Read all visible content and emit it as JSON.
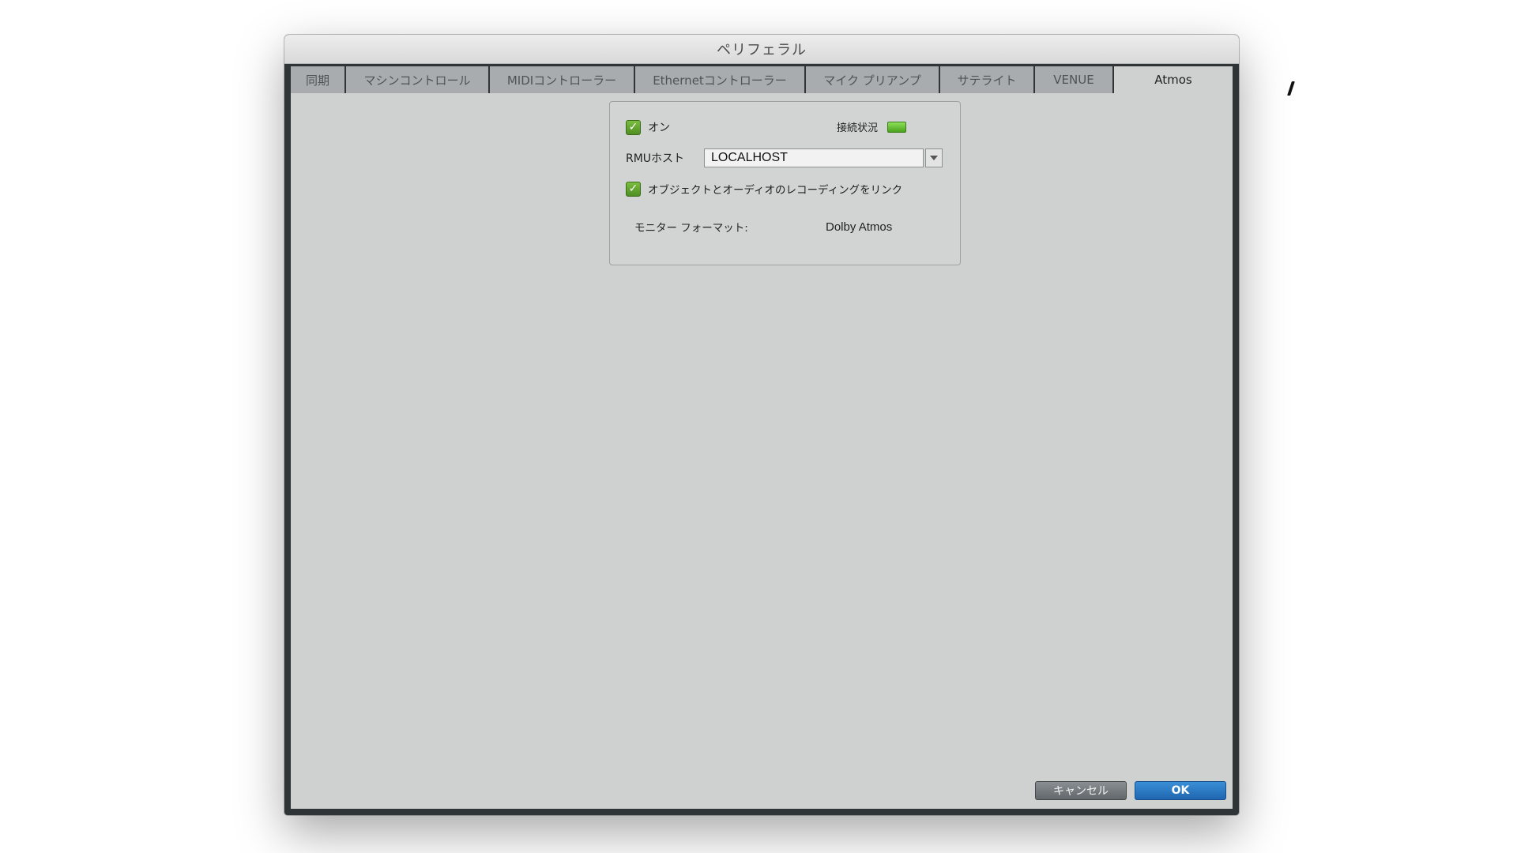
{
  "window": {
    "title": "ペリフェラル"
  },
  "tabs": [
    {
      "label": "同期"
    },
    {
      "label": "マシンコントロール"
    },
    {
      "label": "MIDIコントローラー"
    },
    {
      "label": "Ethernetコントローラー"
    },
    {
      "label": "マイク プリアンプ"
    },
    {
      "label": "サテライト"
    },
    {
      "label": "VENUE"
    },
    {
      "label": "Atmos",
      "active": true
    }
  ],
  "atmos": {
    "on_label": "オン",
    "on_checked": true,
    "connection_label": "接続状況",
    "connection_status_color": "#5fc22e",
    "rmu_host_label": "RMUホスト",
    "rmu_host_value": "LOCALHOST",
    "link_label": "オブジェクトとオーディオのレコーディングをリンク",
    "link_checked": true,
    "monitor_format_label": "モニター フォーマット:",
    "monitor_format_value": "Dolby Atmos"
  },
  "footer": {
    "cancel_label": "キャンセル",
    "ok_label": "OK"
  },
  "colors": {
    "accent_ok": "#2576c4",
    "check_green": "#5fa02e",
    "dialog_bg": "#cfd0d0",
    "frame": "#2f3437"
  }
}
